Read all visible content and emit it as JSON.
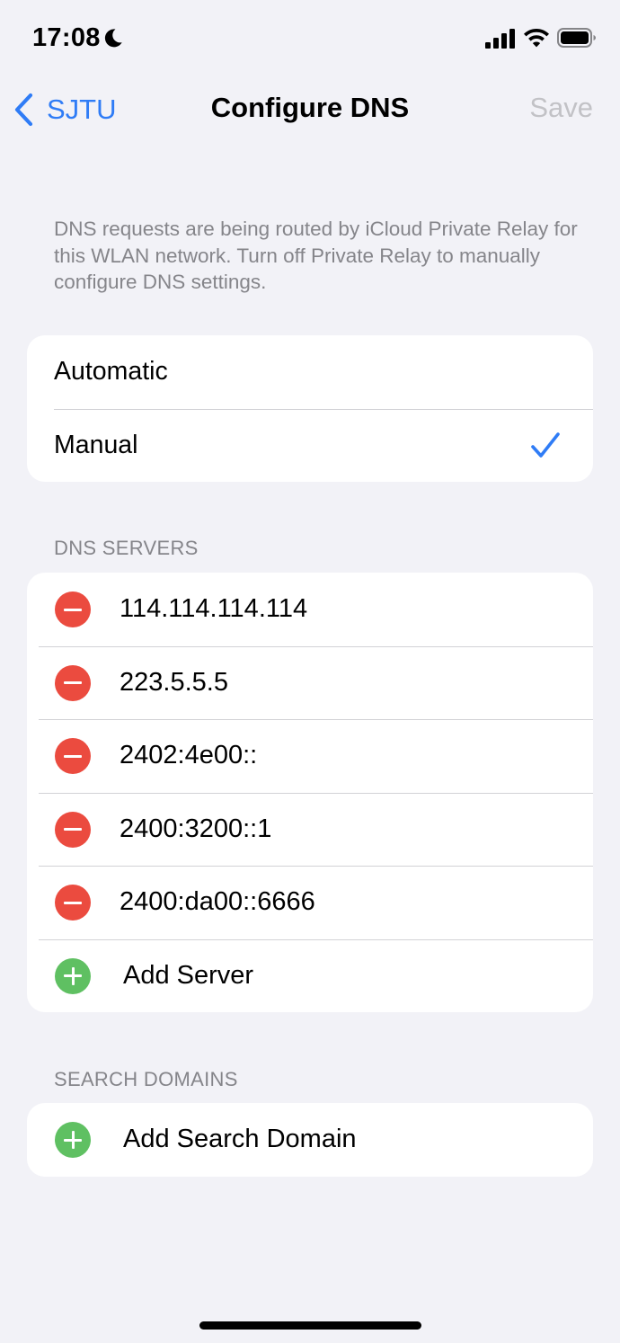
{
  "status_bar": {
    "time": "17:08",
    "focus_icon": "moon-icon",
    "icons": [
      "cellular-signal-icon",
      "wifi-icon",
      "battery-icon"
    ]
  },
  "nav": {
    "back_label": "SJTU",
    "title": "Configure DNS",
    "save_label": "Save"
  },
  "notice": "DNS requests are being routed by iCloud Private Relay for this WLAN network. Turn off Private Relay to manually configure DNS settings.",
  "mode": {
    "options": [
      "Automatic",
      "Manual"
    ],
    "selected": "Manual"
  },
  "dns_servers": {
    "header": "DNS SERVERS",
    "servers": [
      "114.114.114.114",
      "223.5.5.5",
      "2402:4e00::",
      "2400:3200::1",
      "2400:da00::6666"
    ],
    "add_label": "Add Server"
  },
  "search_domains": {
    "header": "SEARCH DOMAINS",
    "add_label": "Add Search Domain"
  },
  "colors": {
    "accent": "#2f7cf6",
    "remove": "#eb4b3f",
    "add": "#5fc062",
    "background": "#f2f2f7",
    "secondary_text": "#85858a",
    "disabled": "#c2c2c6"
  }
}
